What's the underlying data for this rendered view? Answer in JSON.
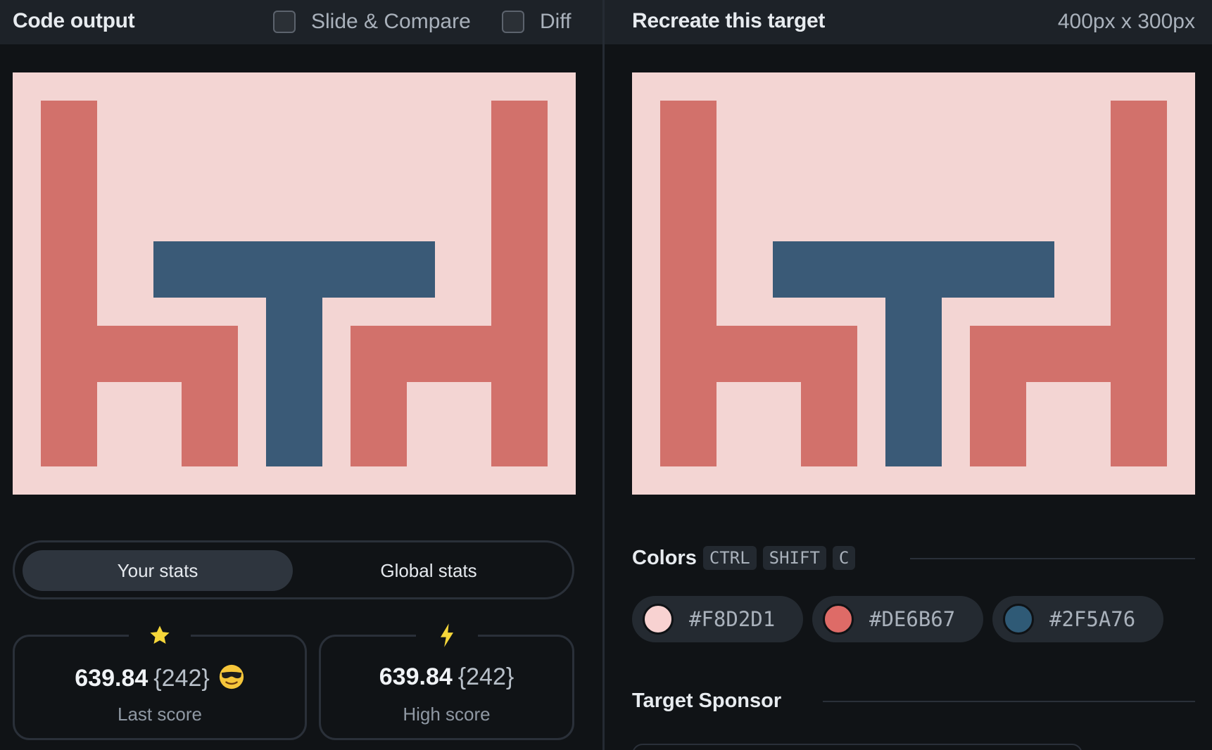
{
  "code_panel": {
    "title": "Code output",
    "slide_compare_label": "Slide & Compare",
    "diff_label": "Diff"
  },
  "target_panel": {
    "title": "Recreate this target",
    "dimensions": "400px x 300px"
  },
  "stats_tabs": {
    "your_stats": "Your stats",
    "global_stats": "Global stats",
    "active": "your_stats"
  },
  "last_score": {
    "score": "639.84",
    "count": "{242}",
    "caption": "Last score",
    "icon": "star-icon",
    "emoji": "sunglasses-face-icon"
  },
  "high_score": {
    "score": "639.84",
    "count": "{242}",
    "caption": "High score",
    "icon": "lightning-icon"
  },
  "colors": {
    "heading": "Colors",
    "shortcut": [
      "CTRL",
      "SHIFT",
      "C"
    ],
    "swatches": [
      {
        "hex": "#F8D2D1"
      },
      {
        "hex": "#DE6B67"
      },
      {
        "hex": "#2F5A76"
      }
    ]
  },
  "sponsor": {
    "heading": "Target Sponsor"
  },
  "palette": {
    "background": "#F3D5D3",
    "chair": "#D2716B",
    "table": "#3A5A77",
    "accent_star": "#F5D63A"
  }
}
